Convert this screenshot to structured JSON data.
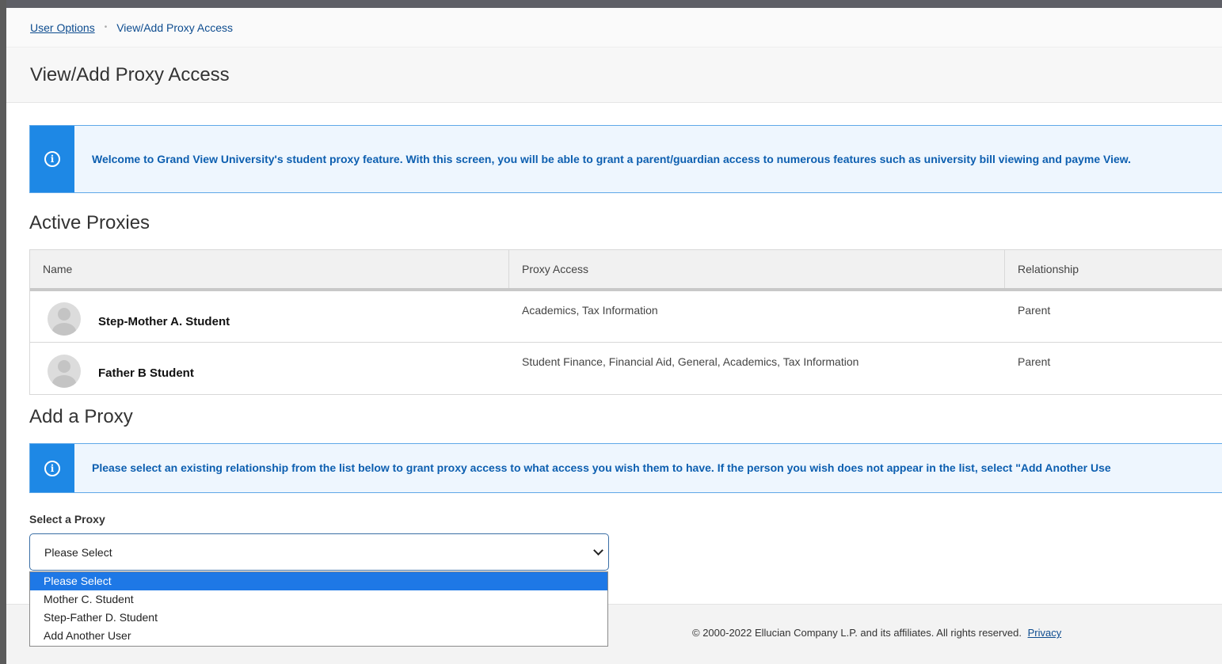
{
  "breadcrumb": {
    "parent": "User Options",
    "separator": "•",
    "current": "View/Add Proxy Access"
  },
  "page": {
    "title": "View/Add Proxy Access"
  },
  "notice_welcome": {
    "icon": "info-icon",
    "text": "Welcome to Grand View University's student proxy feature. With this screen, you will be able to grant a parent/guardian access to numerous features such as university bill viewing and payme View."
  },
  "active_proxies": {
    "heading": "Active Proxies",
    "columns": [
      "Name",
      "Proxy Access",
      "Relationship"
    ],
    "rows": [
      {
        "name": "Step-Mother A. Student",
        "access": "Academics, Tax Information",
        "relationship": "Parent"
      },
      {
        "name": "Father B Student",
        "access": "Student Finance, Financial Aid, General, Academics, Tax Information",
        "relationship": "Parent"
      }
    ]
  },
  "add_proxy": {
    "heading": "Add a Proxy",
    "notice": "Please select an existing relationship from the list below to grant proxy access to what access you wish them to have. If the person you wish does not appear in the list, select \"Add Another Use",
    "select_label": "Select a Proxy",
    "selected_value": "Please Select",
    "options": [
      "Please Select",
      "Mother C. Student",
      "Step-Father D. Student",
      "Add Another User"
    ]
  },
  "footer": {
    "copyright": "© 2000-2022 Ellucian Company L.P. and its affiliates. All rights reserved.",
    "privacy_link": "Privacy"
  }
}
